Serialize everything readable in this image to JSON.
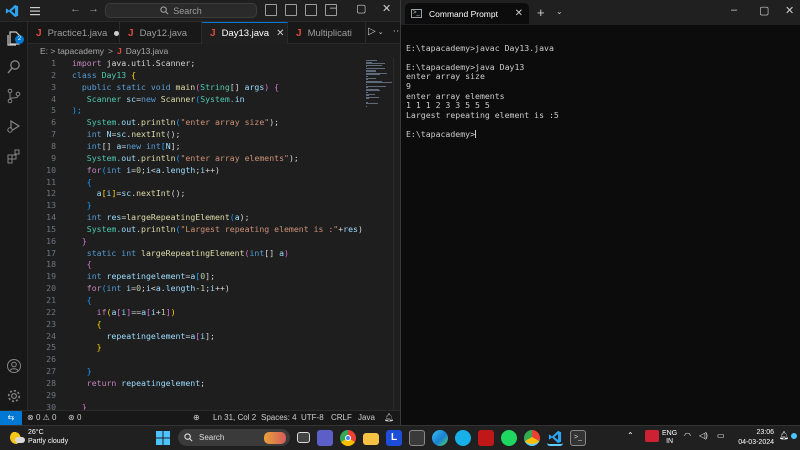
{
  "vscode": {
    "title_search": "Search",
    "nav_back": "←",
    "nav_forward": "→",
    "activity_badge": "2",
    "tabs": [
      {
        "label": "Practice1.java",
        "state": "modified"
      },
      {
        "label": "Day12.java",
        "state": "normal"
      },
      {
        "label": "Day13.java",
        "state": "active"
      },
      {
        "label": "Multiplicati",
        "state": "truncated"
      }
    ],
    "breadcrumb": {
      "folder": "E: > tapacademy",
      "sep": ">",
      "file": "Day13.java"
    },
    "code_lines": [
      {
        "n": "1",
        "tokens": [
          {
            "t": "import ",
            "c": "ctl"
          },
          {
            "t": "java.util.Scanner;",
            "c": "txt"
          }
        ]
      },
      {
        "n": "2",
        "tokens": [
          {
            "t": "class ",
            "c": "kw"
          },
          {
            "t": "Day13 ",
            "c": "type"
          },
          {
            "t": "{",
            "c": "br1"
          }
        ]
      },
      {
        "n": "3",
        "tokens": [
          {
            "t": "  public static void ",
            "c": "kw"
          },
          {
            "t": "main",
            "c": "fn"
          },
          {
            "t": "(",
            "c": "br2"
          },
          {
            "t": "String",
            "c": "type"
          },
          {
            "t": "[] ",
            "c": "txt"
          },
          {
            "t": "args",
            "c": "var"
          },
          {
            "t": ") ",
            "c": "br2"
          },
          {
            "t": "{",
            "c": "br2"
          }
        ]
      },
      {
        "n": "4",
        "tokens": [
          {
            "t": "   Scanner ",
            "c": "type"
          },
          {
            "t": "sc",
            "c": "var"
          },
          {
            "t": "=",
            "c": "txt"
          },
          {
            "t": "new ",
            "c": "kw"
          },
          {
            "t": "Scanner",
            "c": "fn"
          },
          {
            "t": "(",
            "c": "br3"
          },
          {
            "t": "System.",
            "c": "type"
          },
          {
            "t": "in",
            "c": "var"
          }
        ]
      },
      {
        "n": "5",
        "tokens": [
          {
            "t": ");",
            "c": "br3"
          }
        ]
      },
      {
        "n": "6",
        "tokens": [
          {
            "t": "   System.",
            "c": "type"
          },
          {
            "t": "out",
            "c": "var"
          },
          {
            "t": ".",
            "c": "txt"
          },
          {
            "t": "println",
            "c": "fn"
          },
          {
            "t": "(",
            "c": "br3"
          },
          {
            "t": "\"enter array size\"",
            "c": "str"
          },
          {
            "t": ");",
            "c": "txt"
          }
        ]
      },
      {
        "n": "7",
        "tokens": [
          {
            "t": "   int ",
            "c": "kw"
          },
          {
            "t": "N",
            "c": "var"
          },
          {
            "t": "=",
            "c": "txt"
          },
          {
            "t": "sc",
            "c": "var"
          },
          {
            "t": ".",
            "c": "txt"
          },
          {
            "t": "nextInt",
            "c": "fn"
          },
          {
            "t": "();",
            "c": "txt"
          }
        ]
      },
      {
        "n": "8",
        "tokens": [
          {
            "t": "   int",
            "c": "kw"
          },
          {
            "t": "[] ",
            "c": "txt"
          },
          {
            "t": "a",
            "c": "var"
          },
          {
            "t": "=",
            "c": "txt"
          },
          {
            "t": "new int",
            "c": "kw"
          },
          {
            "t": "[",
            "c": "br3"
          },
          {
            "t": "N",
            "c": "var"
          },
          {
            "t": "];",
            "c": "txt"
          }
        ]
      },
      {
        "n": "9",
        "tokens": [
          {
            "t": "   System.",
            "c": "type"
          },
          {
            "t": "out",
            "c": "var"
          },
          {
            "t": ".",
            "c": "txt"
          },
          {
            "t": "println",
            "c": "fn"
          },
          {
            "t": "(",
            "c": "br3"
          },
          {
            "t": "\"enter array elements\"",
            "c": "str"
          },
          {
            "t": ");",
            "c": "txt"
          }
        ]
      },
      {
        "n": "10",
        "tokens": [
          {
            "t": "   for",
            "c": "ctl"
          },
          {
            "t": "(",
            "c": "br3"
          },
          {
            "t": "int ",
            "c": "kw"
          },
          {
            "t": "i",
            "c": "var"
          },
          {
            "t": "=",
            "c": "txt"
          },
          {
            "t": "0",
            "c": "num"
          },
          {
            "t": ";",
            "c": "txt"
          },
          {
            "t": "i",
            "c": "var"
          },
          {
            "t": "<",
            "c": "txt"
          },
          {
            "t": "a",
            "c": "var"
          },
          {
            "t": ".",
            "c": "txt"
          },
          {
            "t": "length",
            "c": "var"
          },
          {
            "t": ";",
            "c": "txt"
          },
          {
            "t": "i",
            "c": "var"
          },
          {
            "t": "++)",
            "c": "txt"
          }
        ]
      },
      {
        "n": "11",
        "tokens": [
          {
            "t": "   {",
            "c": "br3"
          }
        ]
      },
      {
        "n": "12",
        "tokens": [
          {
            "t": "     a",
            "c": "var"
          },
          {
            "t": "[",
            "c": "br1"
          },
          {
            "t": "i",
            "c": "var"
          },
          {
            "t": "]",
            "c": "br1"
          },
          {
            "t": "=",
            "c": "txt"
          },
          {
            "t": "sc",
            "c": "var"
          },
          {
            "t": ".",
            "c": "txt"
          },
          {
            "t": "nextInt",
            "c": "fn"
          },
          {
            "t": "();",
            "c": "txt"
          }
        ]
      },
      {
        "n": "13",
        "tokens": [
          {
            "t": "   }",
            "c": "br3"
          }
        ]
      },
      {
        "n": "14",
        "tokens": [
          {
            "t": "   int ",
            "c": "kw"
          },
          {
            "t": "res",
            "c": "var"
          },
          {
            "t": "=",
            "c": "txt"
          },
          {
            "t": "largeRepeatingElement",
            "c": "fn"
          },
          {
            "t": "(",
            "c": "br3"
          },
          {
            "t": "a",
            "c": "var"
          },
          {
            "t": ");",
            "c": "txt"
          }
        ]
      },
      {
        "n": "15",
        "tokens": [
          {
            "t": "   System.",
            "c": "type"
          },
          {
            "t": "out",
            "c": "var"
          },
          {
            "t": ".",
            "c": "txt"
          },
          {
            "t": "println",
            "c": "fn"
          },
          {
            "t": "(",
            "c": "br3"
          },
          {
            "t": "\"Largest repeating element is :\"",
            "c": "str"
          },
          {
            "t": "+",
            "c": "txt"
          },
          {
            "t": "res",
            "c": "var"
          },
          {
            "t": ");",
            "c": "txt"
          }
        ]
      },
      {
        "n": "16",
        "tokens": [
          {
            "t": "  }",
            "c": "br2"
          }
        ]
      },
      {
        "n": "17",
        "tokens": [
          {
            "t": "   static int ",
            "c": "kw"
          },
          {
            "t": "largeRepeatingElement",
            "c": "fn"
          },
          {
            "t": "(",
            "c": "br2"
          },
          {
            "t": "int",
            "c": "kw"
          },
          {
            "t": "[] ",
            "c": "txt"
          },
          {
            "t": "a",
            "c": "var"
          },
          {
            "t": ")",
            "c": "br2"
          }
        ]
      },
      {
        "n": "18",
        "tokens": [
          {
            "t": "   {",
            "c": "br2"
          }
        ]
      },
      {
        "n": "19",
        "tokens": [
          {
            "t": "   int ",
            "c": "kw"
          },
          {
            "t": "repeatingelement",
            "c": "var"
          },
          {
            "t": "=",
            "c": "txt"
          },
          {
            "t": "a",
            "c": "var"
          },
          {
            "t": "[",
            "c": "br3"
          },
          {
            "t": "0",
            "c": "num"
          },
          {
            "t": "];",
            "c": "txt"
          }
        ]
      },
      {
        "n": "20",
        "tokens": [
          {
            "t": "   for",
            "c": "ctl"
          },
          {
            "t": "(",
            "c": "br3"
          },
          {
            "t": "int ",
            "c": "kw"
          },
          {
            "t": "i",
            "c": "var"
          },
          {
            "t": "=",
            "c": "txt"
          },
          {
            "t": "0",
            "c": "num"
          },
          {
            "t": ";",
            "c": "txt"
          },
          {
            "t": "i",
            "c": "var"
          },
          {
            "t": "<",
            "c": "txt"
          },
          {
            "t": "a",
            "c": "var"
          },
          {
            "t": ".",
            "c": "txt"
          },
          {
            "t": "length",
            "c": "var"
          },
          {
            "t": "-",
            "c": "txt"
          },
          {
            "t": "1",
            "c": "num"
          },
          {
            "t": ";",
            "c": "txt"
          },
          {
            "t": "i",
            "c": "var"
          },
          {
            "t": "++)",
            "c": "txt"
          }
        ]
      },
      {
        "n": "21",
        "tokens": [
          {
            "t": "   {",
            "c": "br3"
          }
        ]
      },
      {
        "n": "22",
        "tokens": [
          {
            "t": "     if",
            "c": "ctl"
          },
          {
            "t": "(",
            "c": "br1"
          },
          {
            "t": "a",
            "c": "var"
          },
          {
            "t": "[",
            "c": "br2"
          },
          {
            "t": "i",
            "c": "var"
          },
          {
            "t": "]",
            "c": "br2"
          },
          {
            "t": "==",
            "c": "txt"
          },
          {
            "t": "a",
            "c": "var"
          },
          {
            "t": "[",
            "c": "br2"
          },
          {
            "t": "i",
            "c": "var"
          },
          {
            "t": "+",
            "c": "txt"
          },
          {
            "t": "1",
            "c": "num"
          },
          {
            "t": "]",
            "c": "br2"
          },
          {
            "t": ")",
            "c": "br1"
          }
        ]
      },
      {
        "n": "23",
        "tokens": [
          {
            "t": "     {",
            "c": "br1"
          }
        ]
      },
      {
        "n": "24",
        "tokens": [
          {
            "t": "       repeatingelement",
            "c": "var"
          },
          {
            "t": "=",
            "c": "txt"
          },
          {
            "t": "a",
            "c": "var"
          },
          {
            "t": "[",
            "c": "br2"
          },
          {
            "t": "i",
            "c": "var"
          },
          {
            "t": "];",
            "c": "txt"
          }
        ]
      },
      {
        "n": "25",
        "tokens": [
          {
            "t": "     }",
            "c": "br1"
          }
        ]
      },
      {
        "n": "26",
        "tokens": []
      },
      {
        "n": "27",
        "tokens": [
          {
            "t": "   }",
            "c": "br3"
          }
        ]
      },
      {
        "n": "28",
        "tokens": [
          {
            "t": "   return ",
            "c": "ctl"
          },
          {
            "t": "repeatingelement",
            "c": "var"
          },
          {
            "t": ";",
            "c": "txt"
          }
        ]
      },
      {
        "n": "29",
        "tokens": []
      },
      {
        "n": "30",
        "tokens": [
          {
            "t": "  }",
            "c": "br2"
          }
        ]
      }
    ],
    "status": {
      "errors": "0",
      "warnings": "0",
      "ports": "0",
      "position": "Ln 31, Col 2",
      "spaces": "Spaces: 4",
      "encoding": "UTF-8",
      "eol": "CRLF",
      "language": "Java"
    }
  },
  "cmd": {
    "title": "Command Prompt",
    "lines": [
      "",
      "E:\\tapacademy>javac Day13.java",
      "",
      "E:\\tapacademy>java Day13",
      "enter array size",
      "9",
      "enter array elements",
      "1 1 1 2 3 3 5 5 5",
      "Largest repeating element is :5",
      "",
      "E:\\tapacademy>"
    ]
  },
  "taskbar": {
    "weather_temp": "26°C",
    "weather_desc": "Partly cloudy",
    "search_label": "Search",
    "lang_1": "ENG",
    "lang_2": "IN",
    "time": "23:06",
    "date": "04-03-2024"
  },
  "colors": {
    "accent": "#0078d4",
    "java_icon": "#e04a3f"
  }
}
